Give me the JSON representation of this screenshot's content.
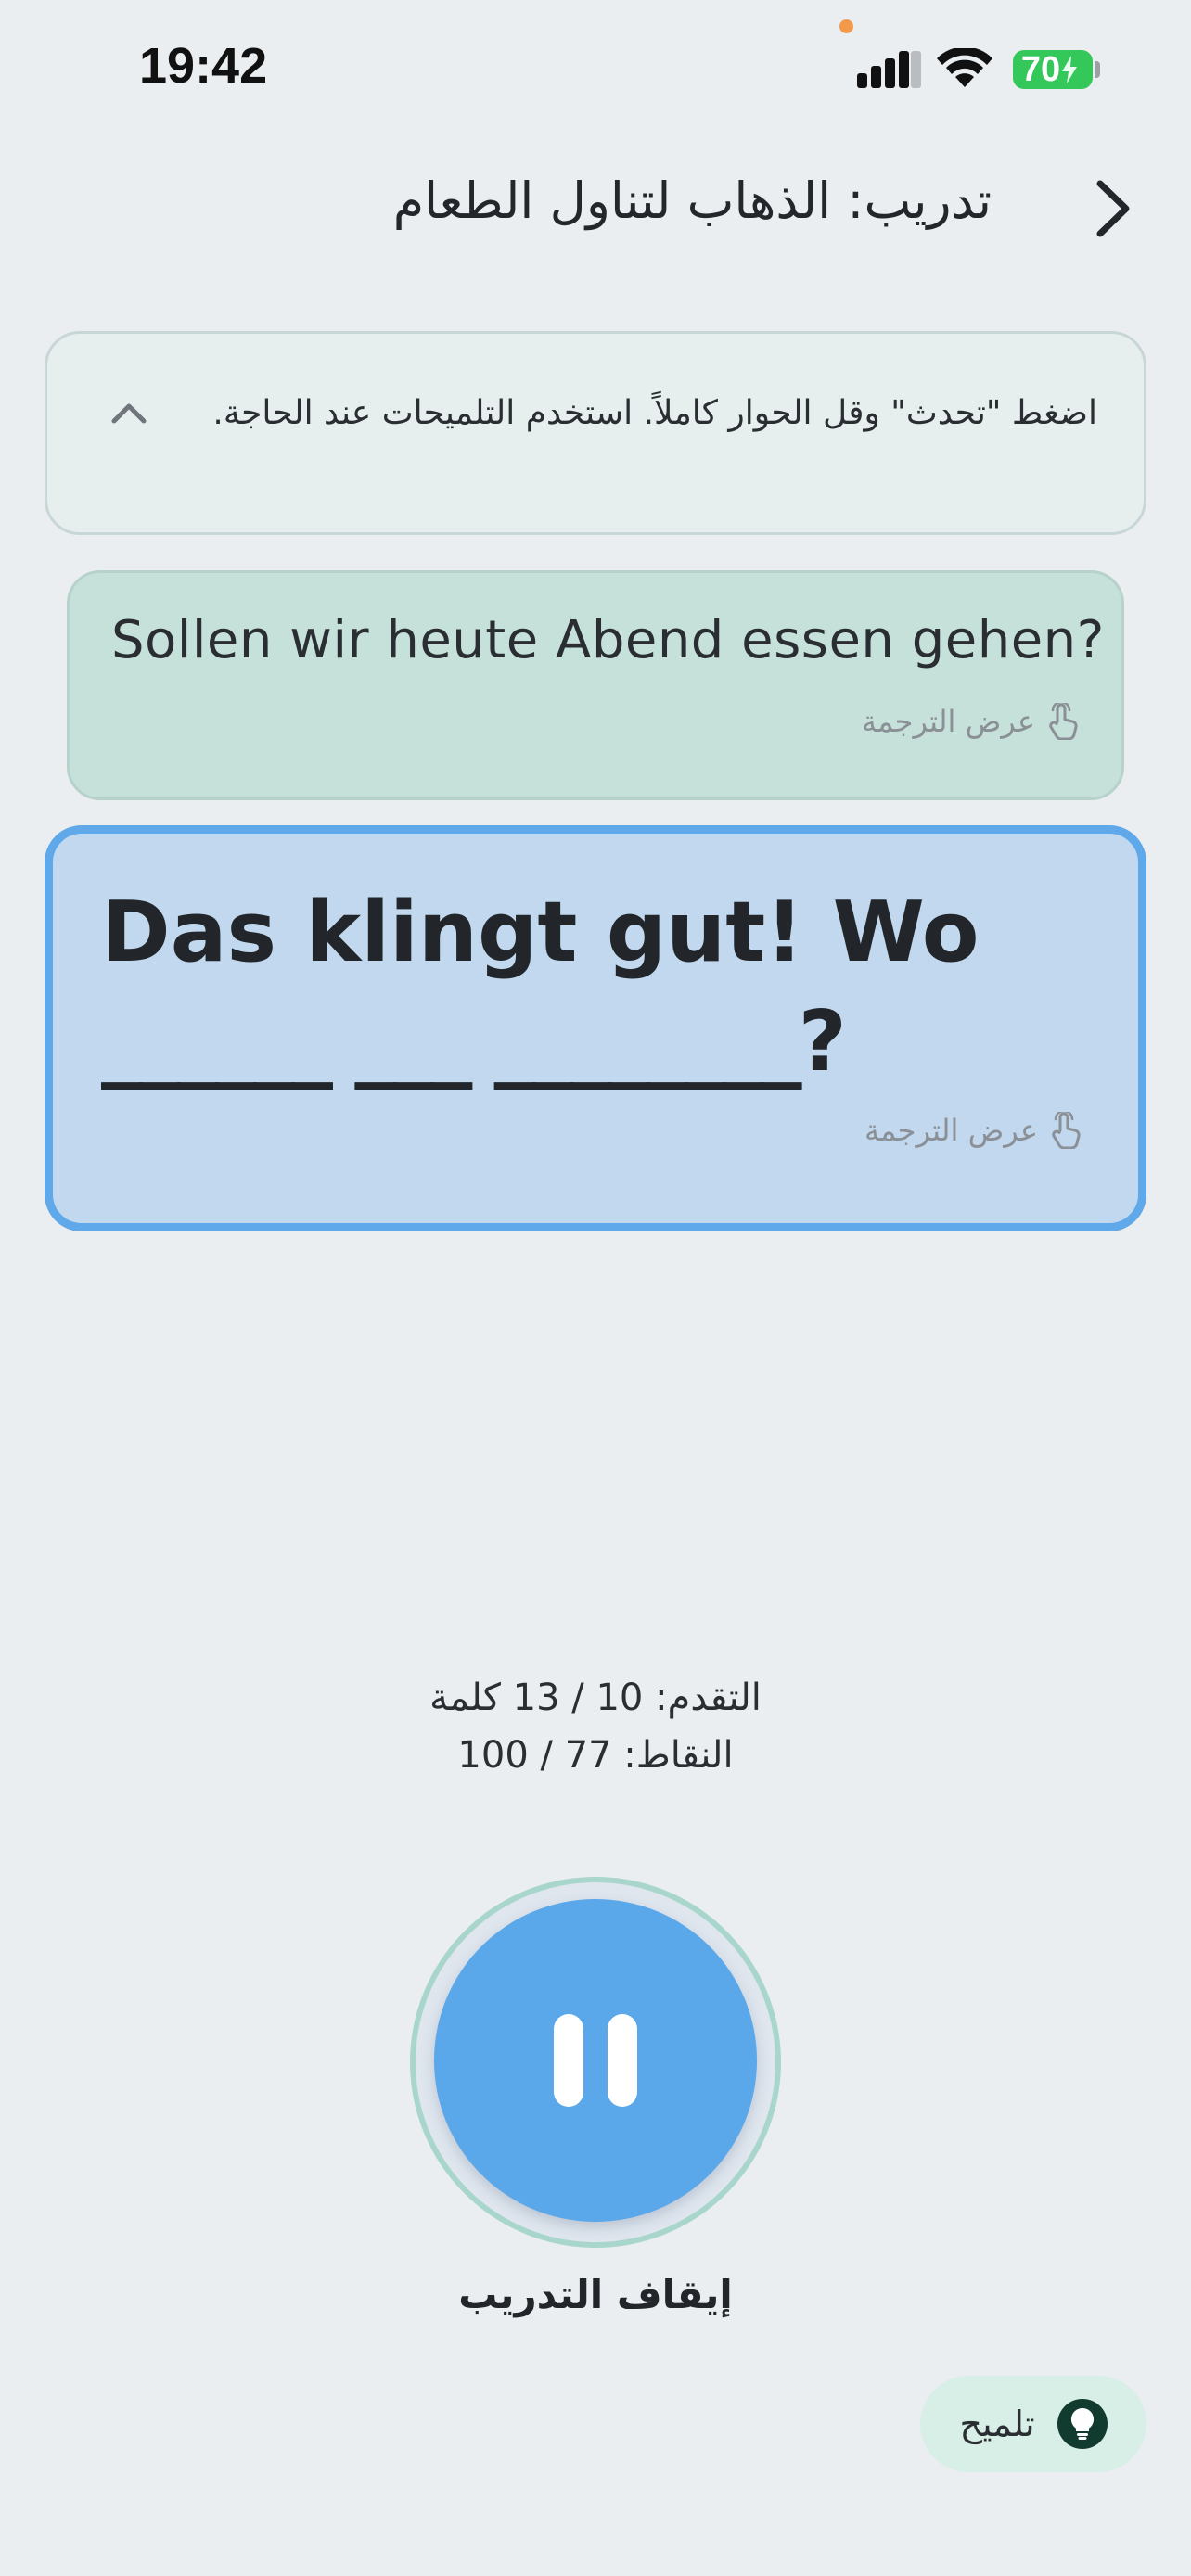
{
  "status_bar": {
    "time": "19:42",
    "battery": "70"
  },
  "header": {
    "title": "تدريب: الذهاب لتناول الطعام"
  },
  "instruction": {
    "text": "اضغط \"تحدث\" وقل الحوار كاملاً. استخدم التلميحات عند الحاجة."
  },
  "partner_bubble": {
    "text": "Sollen wir heute Abend essen gehen?",
    "translate_label": "عرض الترجمة"
  },
  "user_bubble": {
    "line1": "Das klingt gut! Wo",
    "line2": "______ ___ ________?",
    "translate_label": "عرض الترجمة"
  },
  "progress": {
    "text": "التقدم: 10 / 13 كلمة",
    "score": "النقاط: 77 / 100"
  },
  "controls": {
    "stop_label": "إيقاف التدريب",
    "hint_label": "تلميح"
  },
  "colors": {
    "accent": "#5aa7ea",
    "partner_bubble": "#c5e1d9",
    "user_bubble": "#c1d8ee",
    "battery": "#34c759"
  }
}
